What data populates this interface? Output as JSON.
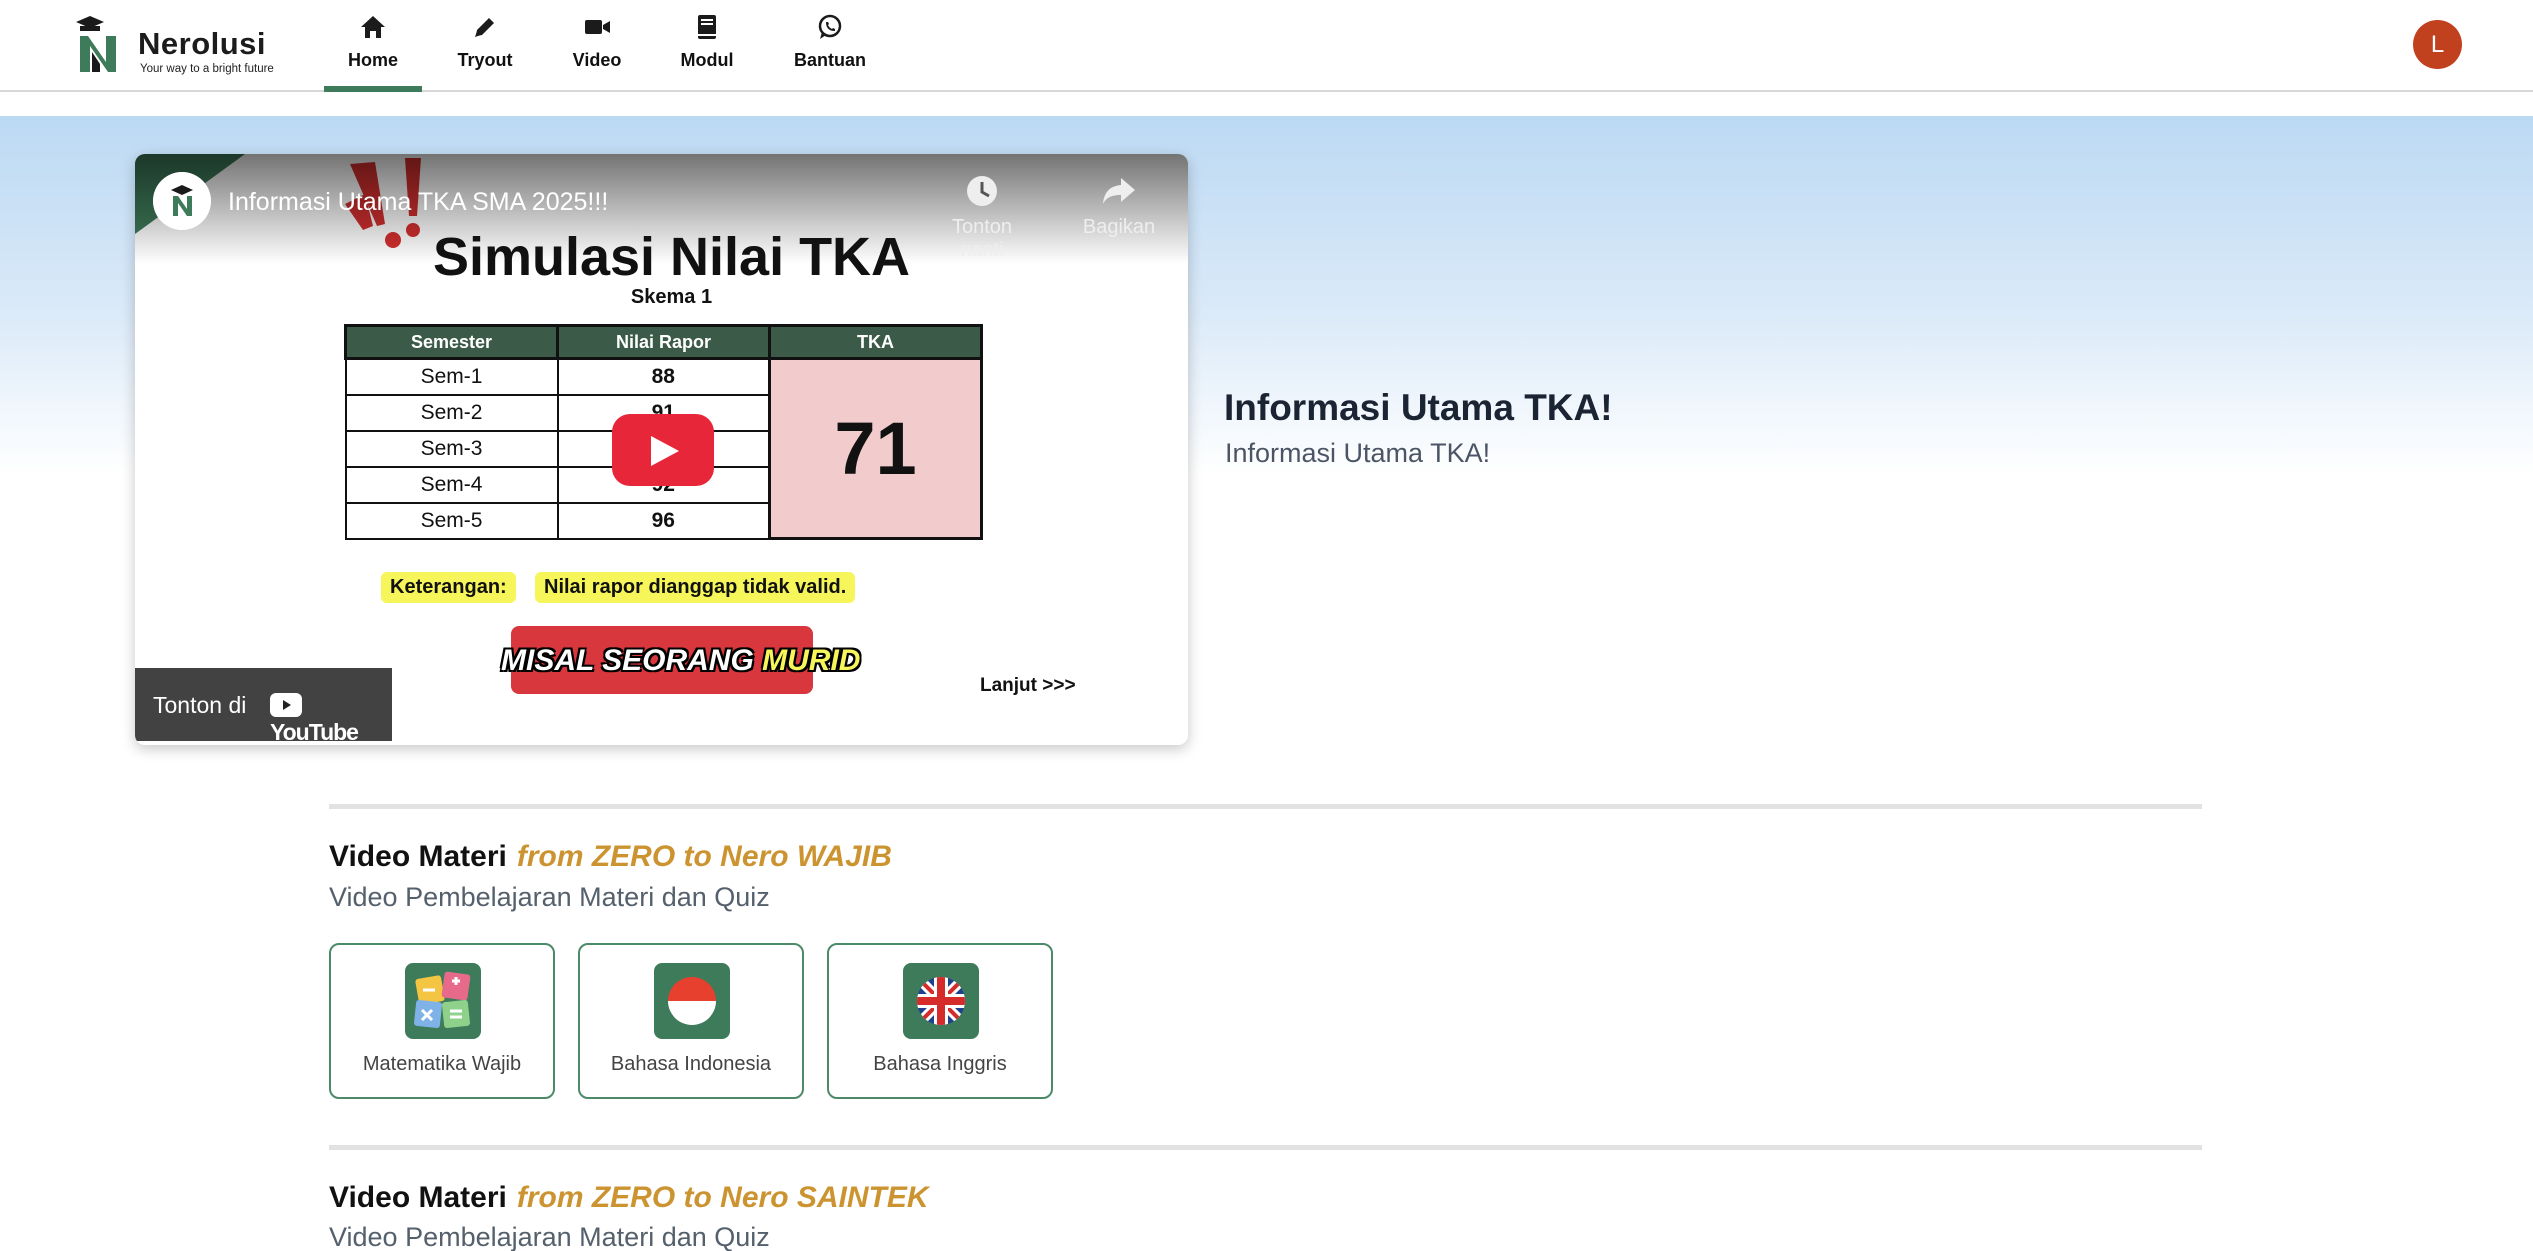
{
  "nav": {
    "brand": "Nerolusi",
    "tagline": "Your way to a bright future",
    "items": [
      {
        "label": "Home",
        "icon": "home-icon"
      },
      {
        "label": "Tryout",
        "icon": "pencil-icon"
      },
      {
        "label": "Video",
        "icon": "video-camera-icon"
      },
      {
        "label": "Modul",
        "icon": "book-icon"
      },
      {
        "label": "Bantuan",
        "icon": "whatsapp-icon"
      }
    ],
    "active": "Home",
    "avatar_initial": "L"
  },
  "hero": {
    "video": {
      "title": "Informasi Utama TKA SMA 2025!!!",
      "watch_later": "Tonton nanti",
      "share": "Bagikan",
      "watch_on": "Tonton di",
      "watch_on_brand": "YouTube",
      "thumbnail": {
        "heading": "Simulasi Nilai TKA",
        "scheme": "Skema 1",
        "table_headers": [
          "Semester",
          "Nilai Rapor",
          "TKA"
        ],
        "rows": [
          {
            "semester": "Sem-1",
            "nilai": "88"
          },
          {
            "semester": "Sem-2",
            "nilai": "91"
          },
          {
            "semester": "Sem-3",
            "nilai": ""
          },
          {
            "semester": "Sem-4",
            "nilai": "92"
          },
          {
            "semester": "Sem-5",
            "nilai": "96"
          }
        ],
        "tka_value": "71",
        "note_label": "Keterangan:",
        "note_text": "Nilai rapor dianggap tidak valid.",
        "banner_text": "MISAL SEORANG",
        "banner_highlight": "MURID",
        "next": "Lanjut >>>"
      }
    },
    "title": "Informasi Utama TKA!",
    "subtitle": "Informasi Utama TKA!"
  },
  "sections": [
    {
      "title": "Video Materi",
      "accent": "from ZERO to Nero WAJIB",
      "subtitle": "Video Pembelajaran Materi dan Quiz",
      "cards": [
        {
          "label": "Matematika Wajib",
          "icon": "math-icon"
        },
        {
          "label": "Bahasa Indonesia",
          "icon": "indonesia-flag-icon"
        },
        {
          "label": "Bahasa Inggris",
          "icon": "uk-flag-icon"
        }
      ]
    },
    {
      "title": "Video Materi",
      "accent": "from ZERO to Nero SAINTEK",
      "subtitle": "Video Pembelajaran Materi dan Quiz"
    }
  ],
  "colors": {
    "brand_green": "#3e7b5a",
    "accent_gold": "#cc9431",
    "avatar_bg": "#c1411f",
    "play_red": "#e8263a"
  }
}
